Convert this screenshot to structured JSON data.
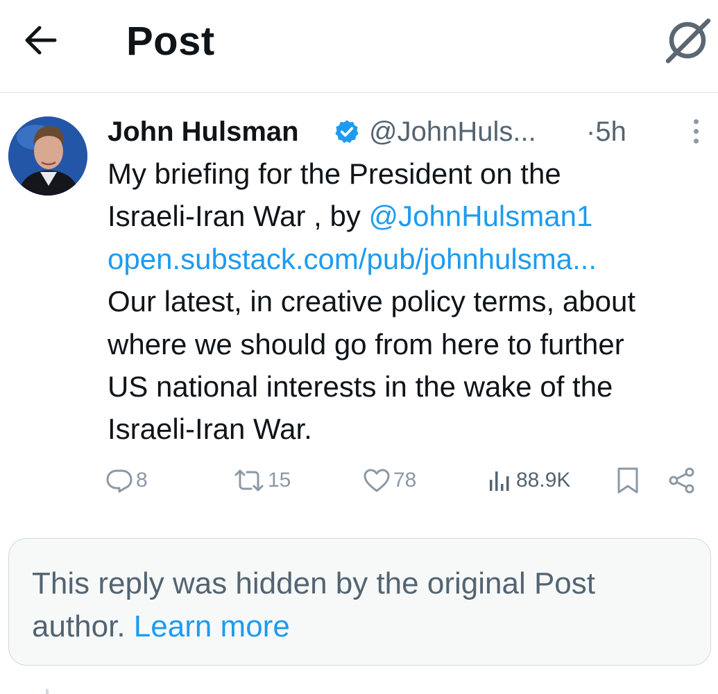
{
  "header": {
    "title": "Post",
    "back_icon": "arrow-left-icon",
    "grok_icon": "grok-slash-circle-icon"
  },
  "post": {
    "author": {
      "name": "John Hulsman",
      "handle": "@JohnHuls...",
      "verified_color": "#1d9bf0",
      "avatar_icon": "user-avatar-photo"
    },
    "time": "·5h",
    "body_lines": [
      {
        "text": "My briefing for the President on the"
      },
      {
        "text": "Israeli-Iran War , by ",
        "link": "@JohnHulsman1"
      },
      {
        "link": "open.substack.com/pub/johnhulsma..."
      },
      {
        "text": "Our latest, in creative policy terms, about"
      },
      {
        "text": "where we should go from here to further"
      },
      {
        "text": "US national interests in the wake of the"
      },
      {
        "text": "Israeli-Iran War."
      }
    ],
    "stats": {
      "replies": "8",
      "reposts": "15",
      "likes": "78",
      "views": "88.9K"
    }
  },
  "hidden_reply": {
    "line1": "This reply was hidden by the original Post",
    "line2_text": "author. ",
    "learn_more": "Learn more"
  },
  "colors": {
    "accent": "#1d9bf0",
    "muted": "#536471",
    "icon_gray": "#8b98a5"
  }
}
